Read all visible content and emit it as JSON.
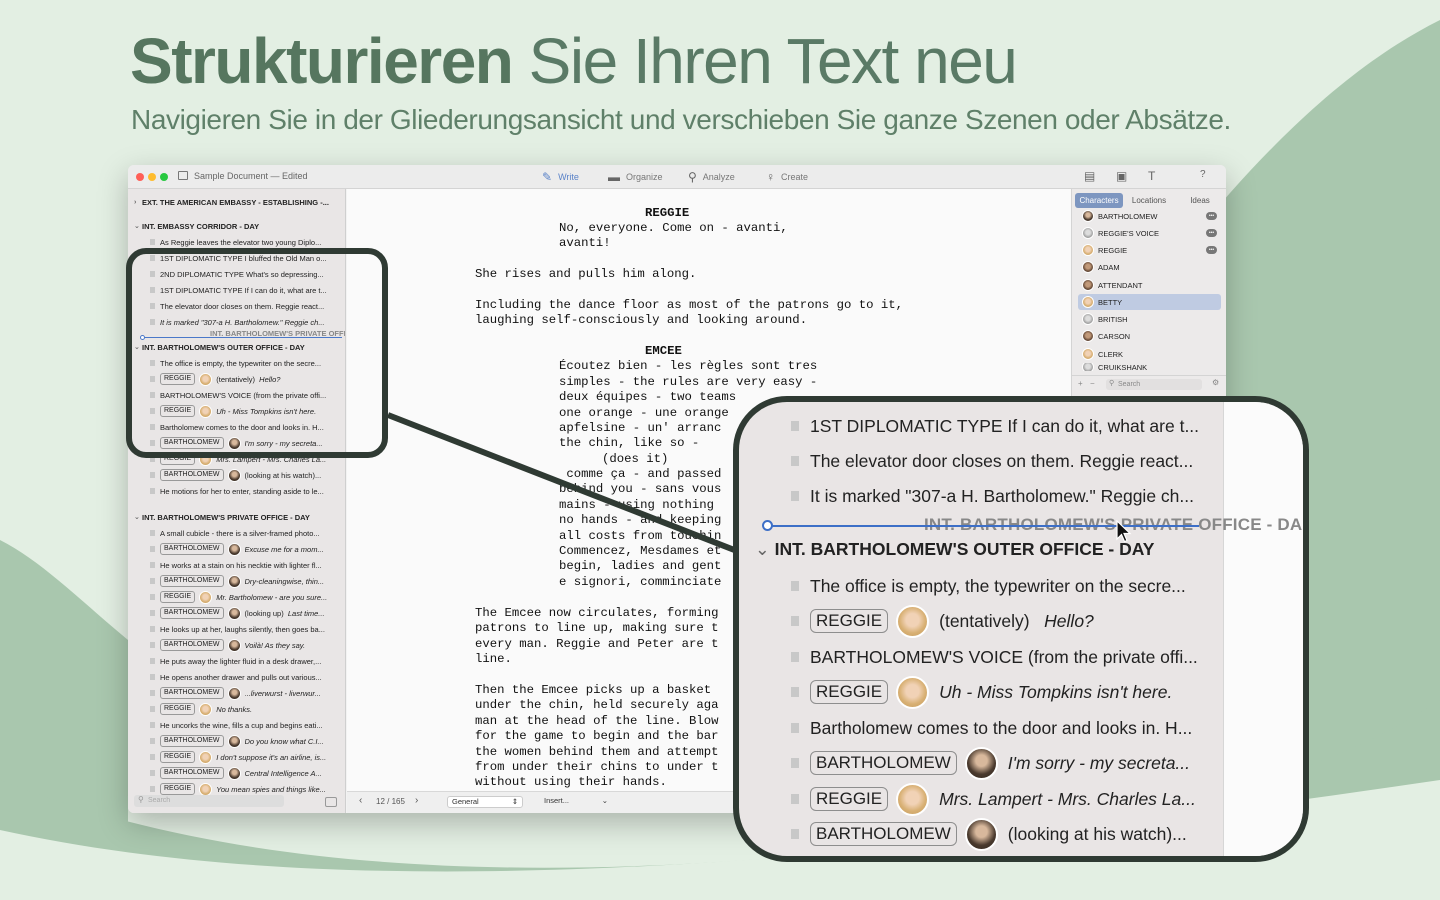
{
  "headline": {
    "bold": "Strukturieren",
    "rest": " Sie Ihren Text neu"
  },
  "subline": "Navigieren Sie in der Gliederungsansicht und verschieben Sie ganze Szenen oder Absätze.",
  "window": {
    "title": "Sample Document",
    "edited": " — Edited",
    "toolbar": [
      {
        "label": "Write",
        "icon": "pencil-icon"
      },
      {
        "label": "Organize",
        "icon": "folder-icon"
      },
      {
        "label": "Analyze",
        "icon": "magnifier-icon"
      },
      {
        "label": "Create",
        "icon": "lightbulb-icon"
      }
    ],
    "help": "?"
  },
  "outline": {
    "scene1": "EXT. THE AMERICAN EMBASSY - ESTABLISHING -...",
    "scene2": "INT. EMBASSY CORRIDOR - DAY",
    "r1": "As Reggie leaves the elevator two young Diplo...",
    "r2": "1ST DIPLOMATIC TYPE I bluffed the Old Man o...",
    "r3": "2ND DIPLOMATIC TYPE What's so depressing...",
    "r4": "1ST DIPLOMATIC TYPE If I can do it, what are t...",
    "r5": "The elevator door closes on them. Reggie react...",
    "r6": "It is marked \"307-a H. Bartholomew.\" Reggie ch...",
    "drag": "INT. BARTHOLOMEW'S PRIVATE OFFICE - DAY",
    "scene3": "INT. BARTHOLOMEW'S OUTER OFFICE - DAY",
    "r7": "The office is empty, the typewriter on the secre...",
    "r8_tag": "REGGIE",
    "r8_paren": "(tentatively)",
    "r8_text": "Hello?",
    "r9": "BARTHOLOMEW'S VOICE  (from the private offi...",
    "r10_tag": "REGGIE",
    "r10_text": "Uh - Miss Tompkins isn't here.",
    "r11": "Bartholomew comes to the door and looks in. H...",
    "r12_tag": "BARTHOLOMEW",
    "r12_text": "I'm sorry - my secreta...",
    "r13_tag": "REGGIE",
    "r13_text": "Mrs. Lampert - Mrs. Charles La...",
    "r14_tag": "BARTHOLOMEW",
    "r14_text": "(looking at his watch)...",
    "r15": "He motions for her to enter, standing aside to le...",
    "scene4": "INT. BARTHOLOMEW'S PRIVATE OFFICE - DAY",
    "r16": "A small cubicle - there is a silver-framed photo...",
    "r17_tag": "BARTHOLOMEW",
    "r17_text": "Excuse me for a mom...",
    "r18": "He works at a stain on his necktie with lighter fl...",
    "r19_tag": "BARTHOLOMEW",
    "r19_text": "Dry-cleaningwise, thin...",
    "r20_tag": "REGGIE",
    "r20_text": "Mr. Bartholomew - are you sure...",
    "r21_tag": "BARTHOLOMEW",
    "r21_paren": "(looking up)",
    "r21_text": "Last time...",
    "r22": "He looks up at her, laughs silently, then goes ba...",
    "r23_tag": "BARTHOLOMEW",
    "r23_text": "Voilà! As they say.",
    "r24": "He puts away the lighter fluid in a desk drawer,...",
    "r25": "He opens another drawer and pulls out various...",
    "r26_tag": "BARTHOLOMEW",
    "r26_text": "...liverwurst - liverwur...",
    "r27_tag": "REGGIE",
    "r27_text": "No thanks.",
    "r28": "He uncorks the wine, fills a cup and begins eati...",
    "r29_tag": "BARTHOLOMEW",
    "r29_text": "Do you know what C.I...",
    "r30_tag": "REGGIE",
    "r30_text": "I don't suppose it's an airline, is...",
    "r31_tag": "BARTHOLOMEW",
    "r31_text": "Central Intelligence A...",
    "r32_tag": "REGGIE",
    "r32_text": "You mean spies and things like...",
    "search_placeholder": "Search"
  },
  "editor": {
    "l1": "REGGIE",
    "l2": "No, everyone. Come on - avanti,",
    "l3": "avanti!",
    "l4": "She rises and pulls him along.",
    "l5": "Including the dance floor as most of the patrons go to it,",
    "l6": "laughing self-consciously and looking around.",
    "l7": "EMCEE",
    "l8": "Écoutez bien - les règles sont tres",
    "l9": "simples - the rules are very easy -",
    "l10": "deux équipes - two teams",
    "l11": "one orange - une orange",
    "l12": "apfelsine - un' arranc",
    "l13": "the chin, like so -",
    "l14": "(does it)",
    "l15": " comme ça - and passed",
    "l16": "behind you - sans vous",
    "l17": "mains - using nothing",
    "l18": "no hands - and keeping",
    "l19": "all costs from touchin",
    "l20": "Commencez, Mesdames et",
    "l21": "begin, ladies and gent",
    "l22": "e signori, comminciate",
    "l23": "The Emcee now circulates, forming",
    "l24": "patrons to line up, making sure t",
    "l25": "every man. Reggie and Peter are t",
    "l26": "line.",
    "l27": "Then the Emcee picks up a basket",
    "l28": "under the chin, held securely aga",
    "l29": "man at the head of the line. Blow",
    "l30": "for the game to begin and the bar",
    "l31": "the women behind them and attempt",
    "l32": "from under their chins to under t",
    "l33": "without using their hands."
  },
  "footer": {
    "page": "12 / 165",
    "style": "General",
    "insert": "Insert..."
  },
  "panel": {
    "tabs": [
      "Characters",
      "Locations",
      "Ideas"
    ],
    "characters": [
      "BARTHOLOMEW",
      "REGGIE'S VOICE",
      "REGGIE",
      "ADAM",
      "ATTENDANT",
      "BETTY",
      "BRITISH",
      "CARSON",
      "CLERK",
      "CRUIKSHANK"
    ],
    "search_placeholder": "Search"
  },
  "zoom": {
    "z1": "1ST DIPLOMATIC TYPE If I can do it, what are t...",
    "z2": "The elevator door closes on them. Reggie react...",
    "z3": "It is marked \"307-a H. Bartholomew.\" Reggie ch...",
    "drag": "INT. BARTHOLOMEW'S PRIVATE OFFICE - DA",
    "scene": "INT. BARTHOLOMEW'S OUTER OFFICE - DAY",
    "z4": "The office is empty, the typewriter on the secre...",
    "z5_tag": "REGGIE",
    "z5_paren": "(tentatively)",
    "z5_text": "Hello?",
    "z6": "BARTHOLOMEW'S VOICE  (from the private offi...",
    "z7_tag": "REGGIE",
    "z7_text": "Uh - Miss Tompkins isn't here.",
    "z8": "Bartholomew comes to the door and looks in. H...",
    "z9_tag": "BARTHOLOMEW",
    "z9_text": "I'm sorry - my secreta...",
    "z10_tag": "REGGIE",
    "z10_text": "Mrs. Lampert - Mrs. Charles La...",
    "z11_tag": "BARTHOLOMEW",
    "z11_text": "(looking at his watch)..."
  },
  "colors": {
    "background": "#e3efe3",
    "wave": "#a9c7ae",
    "accent": "#5b83c8",
    "frame": "#2f3a33"
  }
}
